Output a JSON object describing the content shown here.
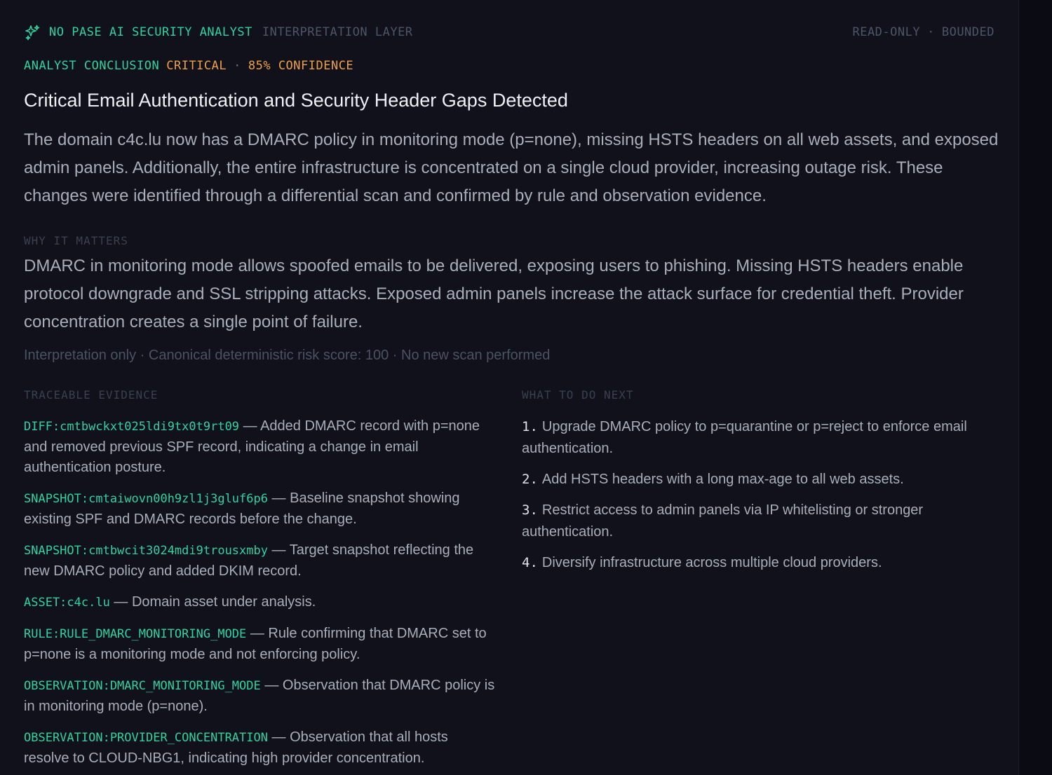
{
  "header": {
    "title": "NO PASE AI SECURITY ANALYST",
    "subtitle": "INTERPRETATION LAYER",
    "mode_read_only": "READ-ONLY",
    "mode_separator": "·",
    "mode_bounded": "BOUNDED",
    "icon": "sparkles-icon"
  },
  "conclusion": {
    "label": "ANALYST CONCLUSION",
    "severity": "CRITICAL",
    "separator": "·",
    "confidence": "85% CONFIDENCE",
    "title": "Critical Email Authentication and Security Header Gaps Detected",
    "summary": "The domain c4c.lu now has a DMARC policy in monitoring mode (p=none), missing HSTS headers on all web assets, and exposed admin panels. Additionally, the entire infrastructure is concentrated on a single cloud provider, increasing outage risk. These changes were identified through a differential scan and confirmed by rule and observation evidence."
  },
  "why_it_matters": {
    "label": "WHY IT MATTERS",
    "text": "DMARC in monitoring mode allows spoofed emails to be delivered, exposing users to phishing. Missing HSTS headers enable protocol downgrade and SSL stripping attacks. Exposed admin panels increase the attack surface for credential theft. Provider concentration creates a single point of failure."
  },
  "note": "Interpretation only · Canonical deterministic risk score: 100 · No new scan performed",
  "evidence": {
    "label": "TRACEABLE EVIDENCE",
    "dash": " — ",
    "items": [
      {
        "ref": "DIFF:cmtbwckxt025ldi9tx0t9rt09",
        "text": "Added DMARC record with p=none and removed previous SPF record, indicating a change in email authentication posture."
      },
      {
        "ref": "SNAPSHOT:cmtaiwovn00h9zl1j3gluf6p6",
        "text": "Baseline snapshot showing existing SPF and DMARC records before the change."
      },
      {
        "ref": "SNAPSHOT:cmtbwcit3024mdi9trousxmby",
        "text": "Target snapshot reflecting the new DMARC policy and added DKIM record."
      },
      {
        "ref": "ASSET:c4c.lu",
        "text": "Domain asset under analysis."
      },
      {
        "ref": "RULE:RULE_DMARC_MONITORING_MODE",
        "text": "Rule confirming that DMARC set to p=none is a monitoring mode and not enforcing policy."
      },
      {
        "ref": "OBSERVATION:DMARC_MONITORING_MODE",
        "text": "Observation that DMARC policy is in monitoring mode (p=none)."
      },
      {
        "ref": "OBSERVATION:PROVIDER_CONCENTRATION",
        "text": "Observation that all hosts resolve to CLOUD-NBG1, indicating high provider concentration."
      }
    ]
  },
  "next_steps": {
    "label": "WHAT TO DO NEXT",
    "items": [
      {
        "num": "1.",
        "text": "Upgrade DMARC policy to p=quarantine or p=reject to enforce email authentication."
      },
      {
        "num": "2.",
        "text": "Add HSTS headers with a long max-age to all web assets."
      },
      {
        "num": "3.",
        "text": "Restrict access to admin panels via IP whitelisting or stronger authentication."
      },
      {
        "num": "4.",
        "text": "Diversify infrastructure across multiple cloud providers."
      }
    ]
  },
  "colors": {
    "accent": "#2ed3a0",
    "warning": "#f0a044",
    "background": "#10111a",
    "muted": "#4e5568"
  }
}
